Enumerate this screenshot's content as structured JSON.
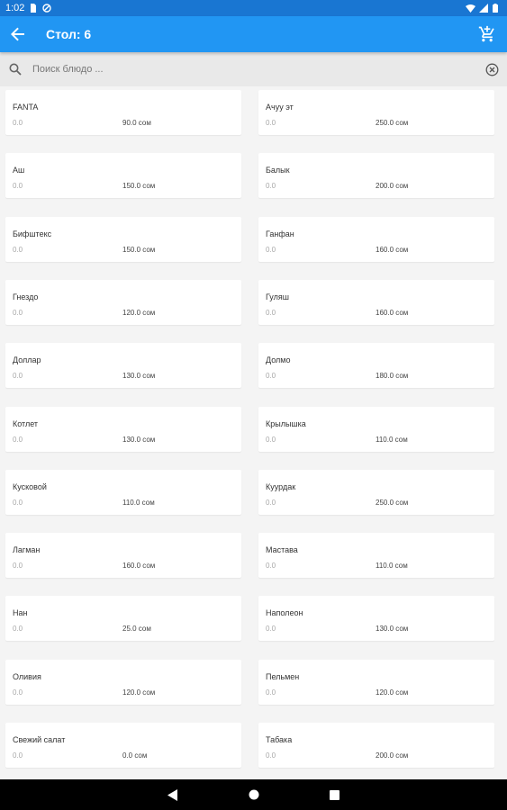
{
  "status_bar": {
    "time": "1:02"
  },
  "app_bar": {
    "title": "Стол: 6"
  },
  "search": {
    "placeholder": "Поиск блюдо ..."
  },
  "dishes": [
    {
      "name": "FANTA",
      "qty": "0.0",
      "price": "90.0 сом"
    },
    {
      "name": "Ачуу эт",
      "qty": "0.0",
      "price": "250.0 сом"
    },
    {
      "name": "Аш",
      "qty": "0.0",
      "price": "150.0 сом"
    },
    {
      "name": "Балык",
      "qty": "0.0",
      "price": "200.0 сом"
    },
    {
      "name": "Бифштекс",
      "qty": "0.0",
      "price": "150.0 сом"
    },
    {
      "name": "Ганфан",
      "qty": "0.0",
      "price": "160.0 сом"
    },
    {
      "name": "Гнездо",
      "qty": "0.0",
      "price": "120.0 сом"
    },
    {
      "name": "Гуляш",
      "qty": "0.0",
      "price": "160.0 сом"
    },
    {
      "name": "Доллар",
      "qty": "0.0",
      "price": "130.0 сом"
    },
    {
      "name": "Долмо",
      "qty": "0.0",
      "price": "180.0 сом"
    },
    {
      "name": "Котлет",
      "qty": "0.0",
      "price": "130.0 сом"
    },
    {
      "name": "Крылышка",
      "qty": "0.0",
      "price": "110.0 сом"
    },
    {
      "name": "Кусковой",
      "qty": "0.0",
      "price": "110.0 сом"
    },
    {
      "name": "Куурдак",
      "qty": "0.0",
      "price": "250.0 сом"
    },
    {
      "name": "Лагман",
      "qty": "0.0",
      "price": "160.0 сом"
    },
    {
      "name": "Мастава",
      "qty": "0.0",
      "price": "110.0 сом"
    },
    {
      "name": "Нан",
      "qty": "0.0",
      "price": "25.0 сом"
    },
    {
      "name": "Наполеон",
      "qty": "0.0",
      "price": "130.0 сом"
    },
    {
      "name": "Оливия",
      "qty": "0.0",
      "price": "120.0 сом"
    },
    {
      "name": "Пельмен",
      "qty": "0.0",
      "price": "120.0 сом"
    },
    {
      "name": "Свежий салат",
      "qty": "0.0",
      "price": "0.0 сом"
    },
    {
      "name": "Табака",
      "qty": "0.0",
      "price": "200.0 сом"
    }
  ],
  "colors": {
    "status_bar": "#1976d2",
    "app_bar": "#2196f3",
    "background": "#f4f4f4"
  }
}
